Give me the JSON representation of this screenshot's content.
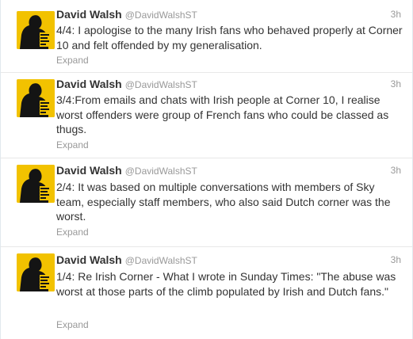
{
  "colors": {
    "avatar_background": "#f2c200",
    "name_text": "#333333",
    "meta_text": "#999999",
    "divider": "#e8e8e8"
  },
  "tweets": [
    {
      "fullname": "David Walsh",
      "username": "@DavidWalshST",
      "time": "3h",
      "text": "4/4: I apologise to the many Irish fans who behaved properly at Corner 10 and felt offended by my generalisation.",
      "expand_label": "Expand"
    },
    {
      "fullname": "David Walsh",
      "username": "@DavidWalshST",
      "time": "3h",
      "text": "3/4:From emails and chats with Irish people at Corner 10, I realise worst offenders were group of French fans who could be classed as thugs.",
      "expand_label": "Expand"
    },
    {
      "fullname": "David Walsh",
      "username": "@DavidWalshST",
      "time": "3h",
      "text": "2/4: It was based on multiple conversations with members of Sky team, especially staff members, who also said Dutch corner was the worst.",
      "expand_label": "Expand"
    },
    {
      "fullname": "David Walsh",
      "username": "@DavidWalshST",
      "time": "3h",
      "text": "1/4: Re Irish Corner - What I wrote in Sunday Times: \"The abuse was worst at those parts of the climb populated by Irish and Dutch fans.\"",
      "expand_label": "Expand"
    }
  ]
}
